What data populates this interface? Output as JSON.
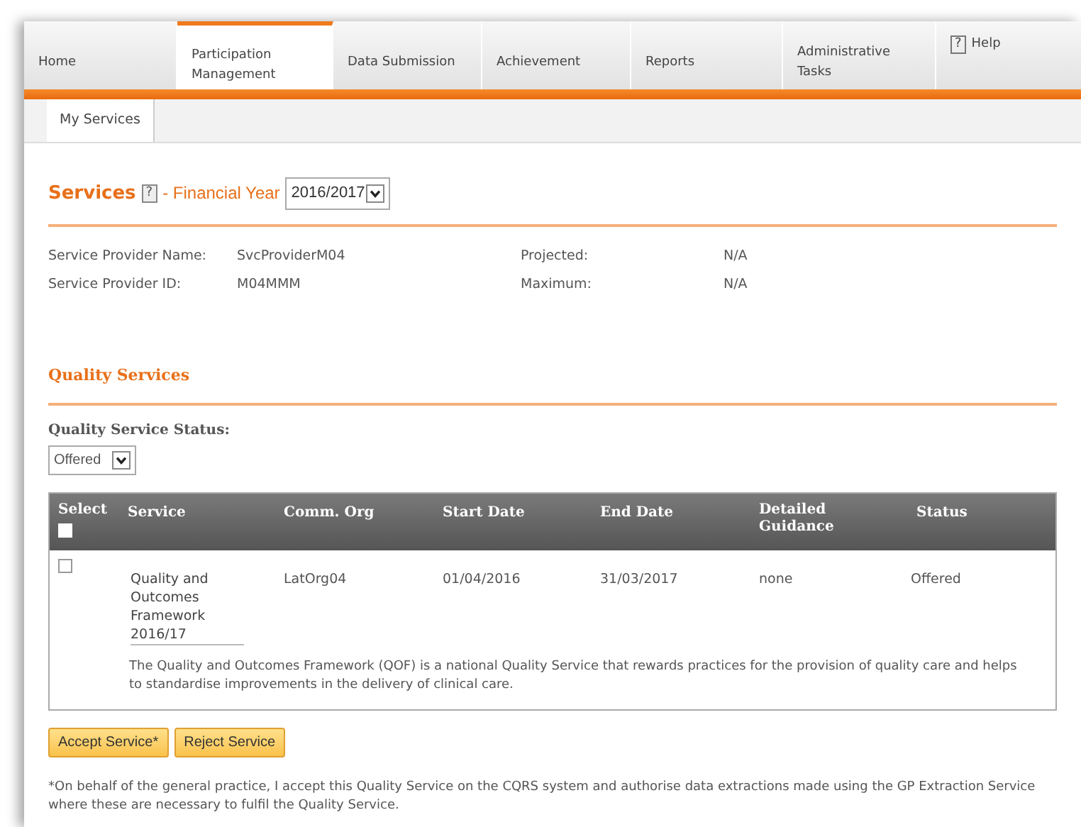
{
  "nav": {
    "tabs": [
      {
        "label": "Home",
        "selected": false
      },
      {
        "label": "Participation Management",
        "selected": true
      },
      {
        "label": "Data Submission",
        "selected": false
      },
      {
        "label": "Achievement",
        "selected": false
      },
      {
        "label": "Reports",
        "selected": false
      },
      {
        "label": "Administrative Tasks",
        "selected": false
      }
    ],
    "help": {
      "mark": "?",
      "label": "Help"
    }
  },
  "subtabs": [
    {
      "label": "My Services",
      "selected": true
    }
  ],
  "services": {
    "title": "Services",
    "help_mark": "?",
    "year_label": "- Financial Year",
    "year_value": "2016/2017",
    "fields": [
      {
        "label": "Service Provider Name:",
        "value": "SvcProviderM04"
      },
      {
        "label": "Projected:",
        "value": "N/A"
      },
      {
        "label": "Service Provider ID:",
        "value": "M04MMM"
      },
      {
        "label": "Maximum:",
        "value": "N/A"
      }
    ]
  },
  "quality": {
    "title": "Quality Services",
    "status_label": "Quality Service Status:",
    "status_value": "Offered",
    "table": {
      "columns": [
        "Select",
        "Service",
        "Comm. Org",
        "Start Date",
        "End Date",
        "Detailed Guidance",
        "Status"
      ],
      "select_all_checked": false,
      "rows": [
        {
          "checked": false,
          "service": "Quality and Outcomes Framework 2016/17",
          "comm_org": "LatOrg04",
          "start_date": "01/04/2016",
          "end_date": "31/03/2017",
          "guidance": "none",
          "status": "Offered",
          "description": "The Quality and Outcomes Framework (QOF) is a national Quality Service that rewards practices for the provision of quality care and helps to standardise improvements in the delivery of clinical care."
        }
      ]
    },
    "buttons": [
      "Accept Service*",
      "Reject Service"
    ],
    "footnote": "*On behalf of the general practice, I accept this Quality Service on the CQRS system and authorise data extractions made using the GP Extraction Service where these are necessary to fulfil the Quality Service."
  }
}
